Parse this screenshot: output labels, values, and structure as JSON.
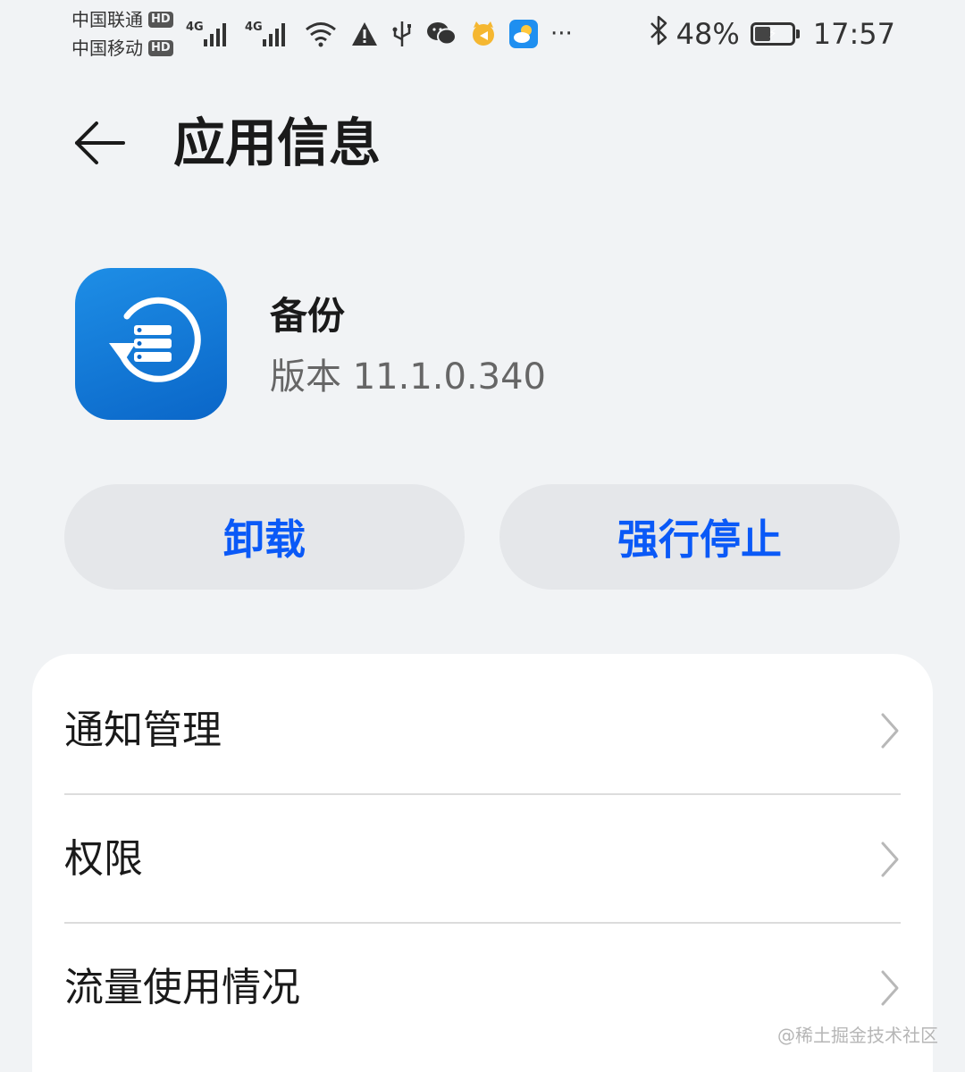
{
  "status_bar": {
    "carrier_1": "中国联通",
    "carrier_2": "中国移动",
    "hd_label": "HD",
    "network_label": "4G",
    "battery": "48%",
    "battery_level": 0.48,
    "time": "17:57",
    "more": "···"
  },
  "header": {
    "title": "应用信息"
  },
  "app": {
    "name": "备份",
    "version": "版本 11.1.0.340"
  },
  "actions": {
    "uninstall": "卸载",
    "force_stop": "强行停止"
  },
  "settings": {
    "items": [
      {
        "label": "通知管理"
      },
      {
        "label": "权限"
      },
      {
        "label": "流量使用情况"
      }
    ]
  },
  "watermark": "@稀土掘金技术社区",
  "colors": {
    "background": "#f1f3f5",
    "accent": "#0a59f7",
    "app_icon": "#0a66c8"
  }
}
